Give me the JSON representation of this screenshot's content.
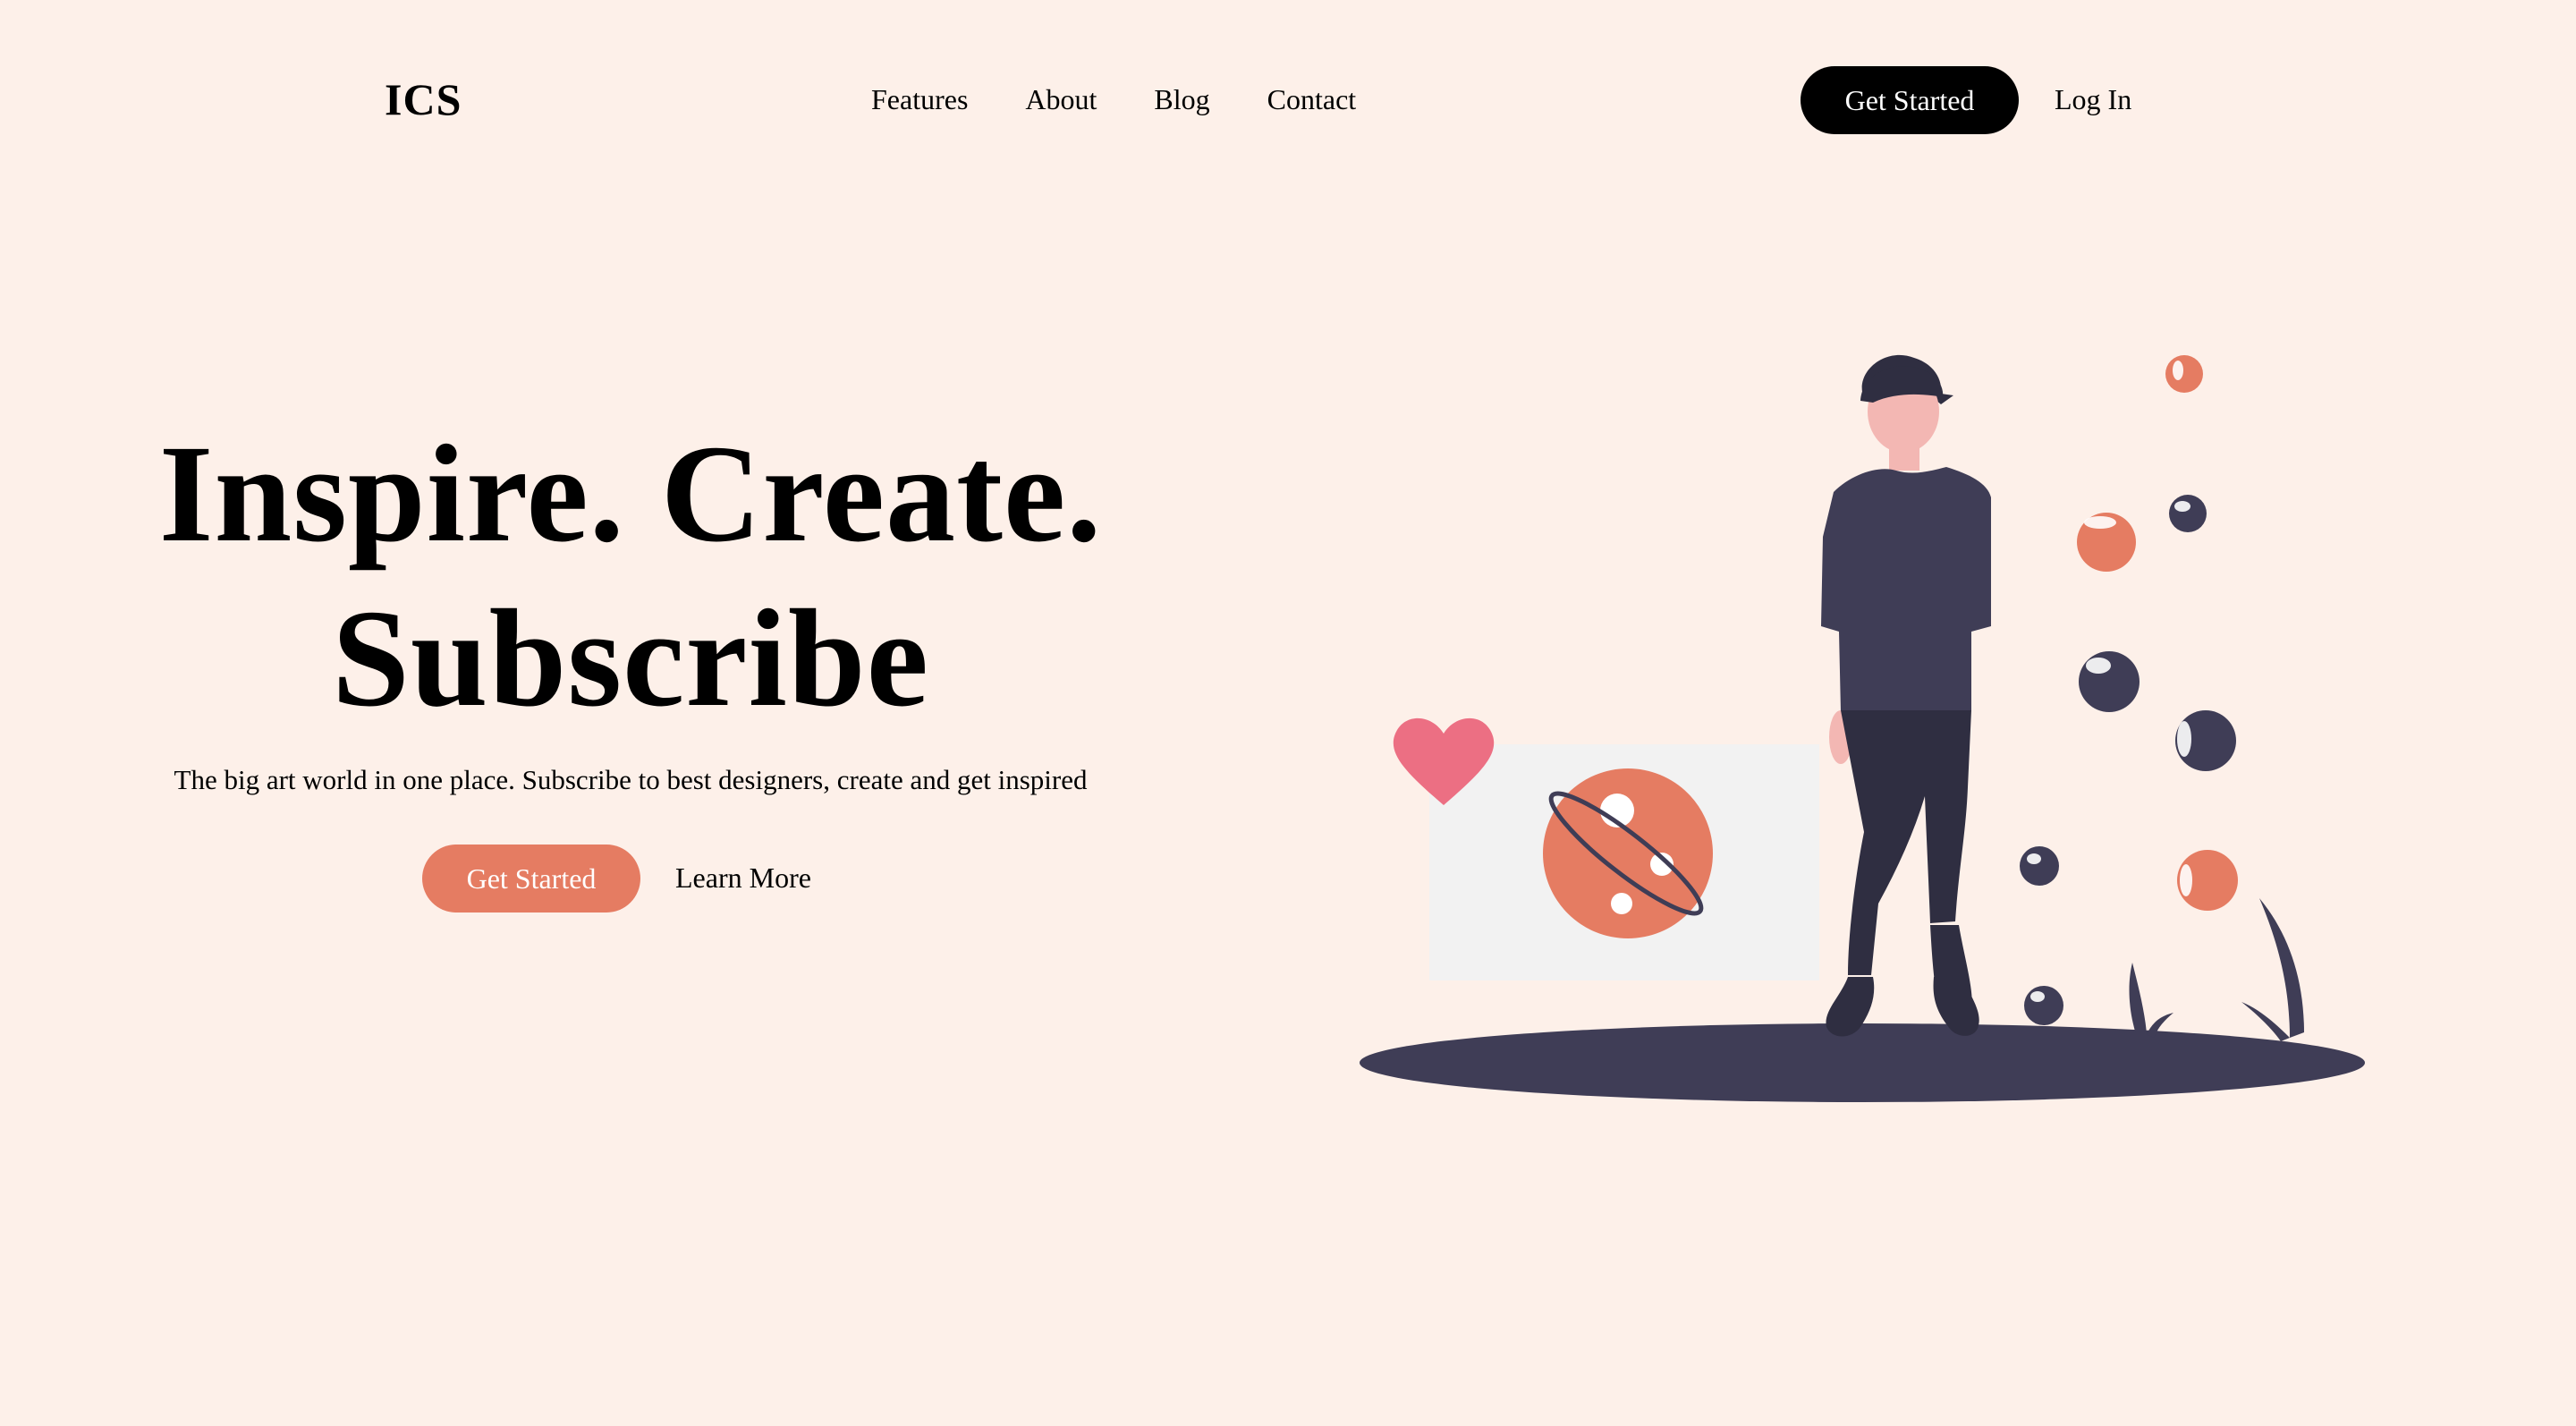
{
  "brand": {
    "logo": "ICS"
  },
  "nav": {
    "links": [
      "Features",
      "About",
      "Blog",
      "Contact"
    ],
    "cta_label": "Get Started",
    "login_label": "Log In"
  },
  "hero": {
    "title_line1": "Inspire. Create.",
    "title_line2": "Subscribe",
    "subtitle": "The big art world in one place. Subscribe to best designers, create and get inspired",
    "primary_cta": "Get Started",
    "secondary_cta": "Learn More"
  },
  "colors": {
    "background": "#fdf0e9",
    "accent": "#e57c62",
    "dark": "#3f3d56",
    "heart": "#ec6f83",
    "button_dark": "#000000"
  }
}
